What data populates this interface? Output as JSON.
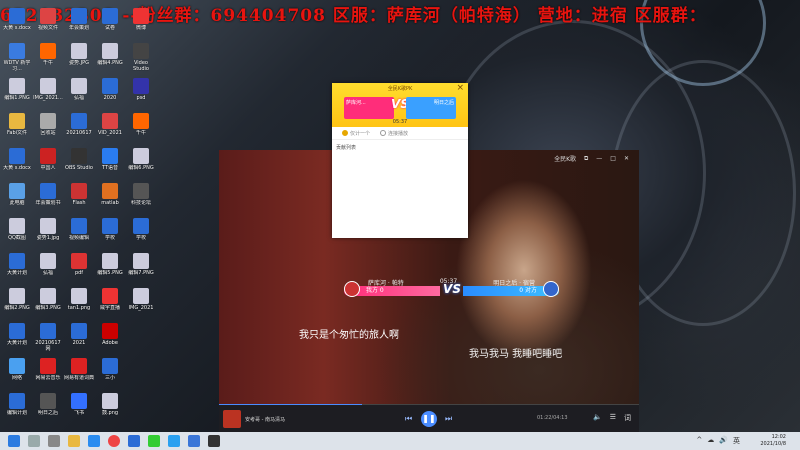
{
  "banner": {
    "text": "632132308 --粉丝群：694404708 区服：萨库河（帕特海） 营地：进宿 区服群："
  },
  "desktop_icons": [
    {
      "label": "大黄 s.docx",
      "icon": "word-icon",
      "color": "#2b6cd6"
    },
    {
      "label": "WDTV 新学习...",
      "icon": "doc-icon",
      "color": "#3a7be0"
    },
    {
      "label": "编辑1.PNG",
      "icon": "image-icon",
      "color": "#ccd"
    },
    {
      "label": "Fabi文件",
      "icon": "folder-icon",
      "color": "#e9b840"
    },
    {
      "label": "大黄 s.docx",
      "icon": "word-icon",
      "color": "#2b6cd6"
    },
    {
      "label": "此电脑",
      "icon": "pc-icon",
      "color": "#5aa0e6"
    },
    {
      "label": "QQ截图",
      "icon": "image-icon",
      "color": "#ccd"
    },
    {
      "label": "大黄计划",
      "icon": "word-icon",
      "color": "#2b6cd6"
    },
    {
      "label": "编辑2.PNG",
      "icon": "image-icon",
      "color": "#ccd"
    },
    {
      "label": "大黄计划",
      "icon": "word-icon",
      "color": "#2b6cd6"
    },
    {
      "label": "网络",
      "icon": "network-icon",
      "color": "#4aa0f0"
    },
    {
      "label": "编辑计划",
      "icon": "word-icon",
      "color": "#2b6cd6"
    },
    {
      "label": "视频文件",
      "icon": "video-icon",
      "color": "#d44"
    },
    {
      "label": "千牛",
      "icon": "app-icon",
      "color": "#f60"
    },
    {
      "label": "IMG_2021...",
      "icon": "image-icon",
      "color": "#ccd"
    },
    {
      "label": "回收站",
      "icon": "recycle-bin-icon",
      "color": "#aaa"
    },
    {
      "label": "中国人",
      "icon": "app-icon",
      "color": "#c22"
    },
    {
      "label": "年会策划书",
      "icon": "word-icon",
      "color": "#2b6cd6"
    },
    {
      "label": "姿势1.jpg",
      "icon": "image-icon",
      "color": "#ccd"
    },
    {
      "label": "弘福",
      "icon": "image-icon",
      "color": "#ccd"
    },
    {
      "label": "编辑3.PNG",
      "icon": "image-icon",
      "color": "#ccd"
    },
    {
      "label": "20210617网",
      "icon": "word-icon",
      "color": "#2b6cd6"
    },
    {
      "label": "网易云音乐",
      "icon": "music-icon",
      "color": "#d22"
    },
    {
      "label": "明日之后",
      "icon": "game-icon",
      "color": "#555"
    },
    {
      "label": "年会策划",
      "icon": "word-icon",
      "color": "#2b6cd6"
    },
    {
      "label": "姿势.JPG",
      "icon": "image-icon",
      "color": "#ccd"
    },
    {
      "label": "弘福",
      "icon": "image-icon",
      "color": "#ccd"
    },
    {
      "label": "20210617",
      "icon": "word-icon",
      "color": "#2b6cd6"
    },
    {
      "label": "OBS Studio",
      "icon": "obs-icon",
      "color": "#333"
    },
    {
      "label": "Flash",
      "icon": "flash-icon",
      "color": "#c33"
    },
    {
      "label": "视频编辑",
      "icon": "word-icon",
      "color": "#2b6cd6"
    },
    {
      "label": "pdf",
      "icon": "pdf-icon",
      "color": "#d33"
    },
    {
      "label": "tan1.png",
      "icon": "image-icon",
      "color": "#ccd"
    },
    {
      "label": "2021",
      "icon": "word-icon",
      "color": "#2b6cd6"
    },
    {
      "label": "网易有道词典",
      "icon": "dict-icon",
      "color": "#d22"
    },
    {
      "label": "飞书",
      "icon": "app-icon",
      "color": "#3370ff"
    },
    {
      "label": "试卷",
      "icon": "word-icon",
      "color": "#2b6cd6"
    },
    {
      "label": "编辑4.PNG",
      "icon": "image-icon",
      "color": "#ccd"
    },
    {
      "label": "2020",
      "icon": "word-icon",
      "color": "#2b6cd6"
    },
    {
      "label": "VID_2021",
      "icon": "video-icon",
      "color": "#d44"
    },
    {
      "label": "TT语音",
      "icon": "app-icon",
      "color": "#2a7cf0"
    },
    {
      "label": "matlab",
      "icon": "app-icon",
      "color": "#e07020"
    },
    {
      "label": "学校",
      "icon": "word-icon",
      "color": "#2b6cd6"
    },
    {
      "label": "编辑5.PNG",
      "icon": "image-icon",
      "color": "#ccd"
    },
    {
      "label": "威宇直播",
      "icon": "app-icon",
      "color": "#e33"
    },
    {
      "label": "Adobe",
      "icon": "adobe-icon",
      "color": "#c00"
    },
    {
      "label": "三小",
      "icon": "word-icon",
      "color": "#2b6cd6"
    },
    {
      "label": "鼓.png",
      "icon": "image-icon",
      "color": "#ccd"
    },
    {
      "label": "微博",
      "icon": "app-icon",
      "color": "#e33"
    },
    {
      "label": "Video Studio",
      "icon": "video-app-icon",
      "color": "#444"
    },
    {
      "label": "psd",
      "icon": "image-icon",
      "color": "#33a"
    },
    {
      "label": "千牛",
      "icon": "app-icon",
      "color": "#f60"
    },
    {
      "label": "编辑6.PNG",
      "icon": "image-icon",
      "color": "#ccd"
    },
    {
      "label": "科技论坛",
      "icon": "app-icon",
      "color": "#555"
    },
    {
      "label": "学校",
      "icon": "word-icon",
      "color": "#2b6cd6"
    },
    {
      "label": "编辑7.PNG",
      "icon": "image-icon",
      "color": "#ccd"
    },
    {
      "label": "IMG_2021",
      "icon": "image-icon",
      "color": "#ccd"
    }
  ],
  "popup": {
    "title": "全民K歌PK",
    "left_name": "萨库河...",
    "right_name": "明日之后",
    "vs": "VS",
    "timer": "05:37",
    "option_a": "仅计一个",
    "option_b": "连接播放",
    "list_header": "贡献列表",
    "close": "×"
  },
  "player": {
    "title": "全民K歌",
    "top_controls": [
      "⧉",
      "—",
      "□",
      "✕"
    ],
    "pk": {
      "left_name": "萨库河 · 帕特",
      "right_name": "明日之后 · 宿营",
      "timer": "05:37",
      "left_score": "我方 0",
      "right_score": "0 对方",
      "vs": "VS"
    },
    "lyric_1": "我只是个匆忙的旅人啊",
    "lyric_2": "我马我马 我睡吧睡吧",
    "song": "安考哥 - 南马清马",
    "time": "01:22/04:13",
    "lyrics_toggle": "词"
  },
  "taskbar": {
    "time": "12:02",
    "date": "2021/10/8",
    "tray": [
      "^",
      "☁",
      "🔊",
      "英"
    ]
  }
}
